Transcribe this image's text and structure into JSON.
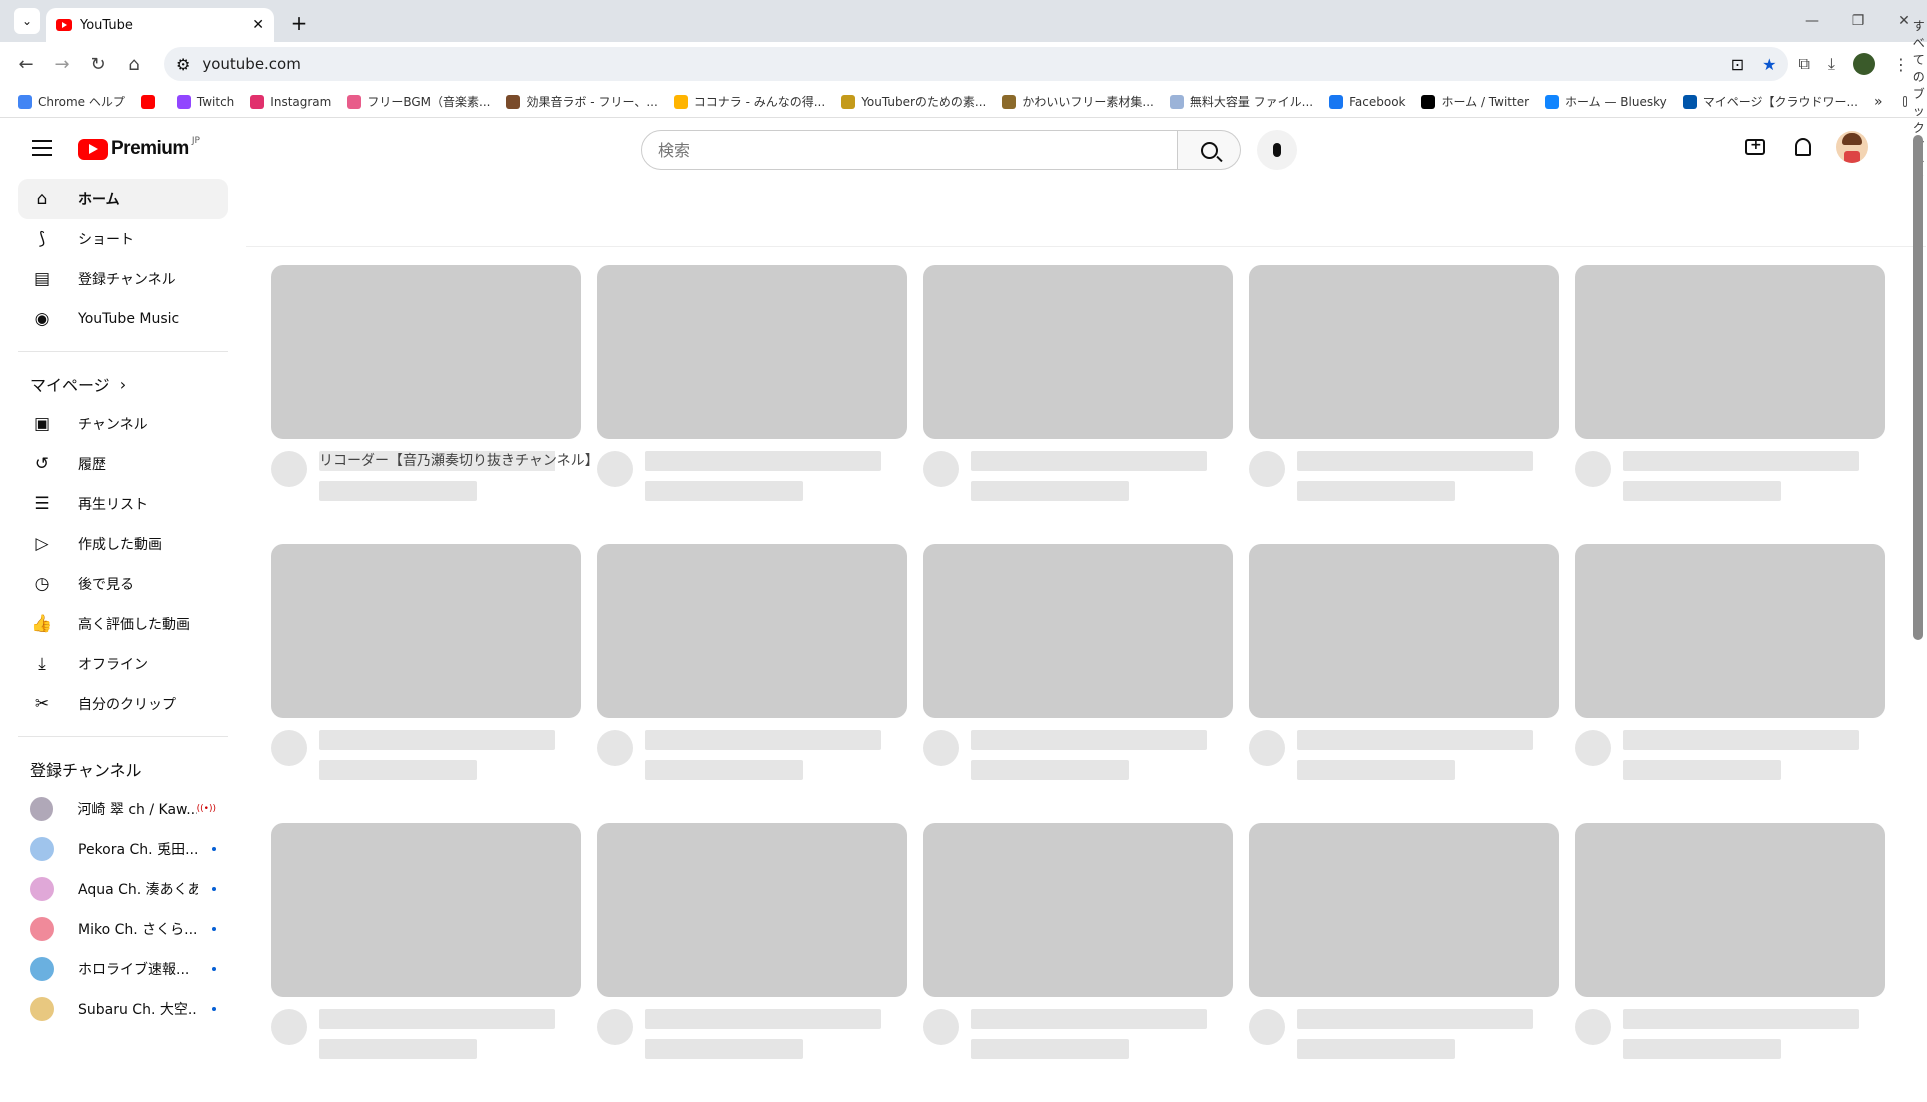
{
  "browser": {
    "tab_title": "YouTube",
    "url": "youtube.com",
    "bookmarks": [
      {
        "label": "Chrome ヘルプ",
        "color": "#4285f4"
      },
      {
        "label": "",
        "color": "#ff0000"
      },
      {
        "label": "Twitch",
        "color": "#9146ff"
      },
      {
        "label": "Instagram",
        "color": "#e1306c"
      },
      {
        "label": "フリーBGM（音楽素...",
        "color": "#e85c8a"
      },
      {
        "label": "効果音ラボ - フリー、...",
        "color": "#7a4b2a"
      },
      {
        "label": "ココナラ - みんなの得...",
        "color": "#ffb400"
      },
      {
        "label": "YouTuberのための素...",
        "color": "#c49a1a"
      },
      {
        "label": "かわいいフリー素材集...",
        "color": "#8b6a2b"
      },
      {
        "label": "無料大容量 ファイル...",
        "color": "#9bb3d8"
      },
      {
        "label": "Facebook",
        "color": "#1877f2"
      },
      {
        "label": "ホーム / Twitter",
        "color": "#000000"
      },
      {
        "label": "ホーム — Bluesky",
        "color": "#1185fe"
      },
      {
        "label": "マイページ【クラウドワー...",
        "color": "#0055aa"
      }
    ],
    "all_bookmarks": "すべてのブックマーク"
  },
  "youtube": {
    "logo_text": "Premium",
    "logo_region": "JP",
    "search_placeholder": "検索",
    "sidebar": {
      "main": [
        {
          "label": "ホーム",
          "icon": "home-icon",
          "glyph": "⌂",
          "active": true
        },
        {
          "label": "ショート",
          "icon": "shorts-icon",
          "glyph": "⟆",
          "active": false
        },
        {
          "label": "登録チャンネル",
          "icon": "subscriptions-icon",
          "glyph": "▤",
          "active": false
        },
        {
          "label": "YouTube Music",
          "icon": "music-icon",
          "glyph": "◉",
          "active": false
        }
      ],
      "mypage_header": "マイページ",
      "mypage": [
        {
          "label": "チャンネル",
          "icon": "channel-icon",
          "glyph": "▣"
        },
        {
          "label": "履歴",
          "icon": "history-icon",
          "glyph": "↺"
        },
        {
          "label": "再生リスト",
          "icon": "playlist-icon",
          "glyph": "☰"
        },
        {
          "label": "作成した動画",
          "icon": "your-videos-icon",
          "glyph": "▷"
        },
        {
          "label": "後で見る",
          "icon": "watch-later-icon",
          "glyph": "◷"
        },
        {
          "label": "高く評価した動画",
          "icon": "liked-icon",
          "glyph": "👍"
        },
        {
          "label": "オフライン",
          "icon": "download-icon",
          "glyph": "⤓"
        },
        {
          "label": "自分のクリップ",
          "icon": "clip-icon",
          "glyph": "✂"
        }
      ],
      "subs_header": "登録チャンネル",
      "subscriptions": [
        {
          "name": "河崎 翠 ch / Kaw...",
          "color": "#b0a8b8",
          "status": "live"
        },
        {
          "name": "Pekora Ch. 兎田...",
          "color": "#9fc4ec",
          "status": "new"
        },
        {
          "name": "Aqua Ch. 湊あくあ",
          "color": "#e0a8d8",
          "status": "new"
        },
        {
          "name": "Miko Ch. さくら...",
          "color": "#f08a9a",
          "status": "new"
        },
        {
          "name": "ホロライブ速報...",
          "color": "#6ab0e0",
          "status": "new"
        },
        {
          "name": "Subaru Ch. 大空...",
          "color": "#e8c880",
          "status": "new"
        }
      ],
      "live_glyph": "((•))"
    },
    "first_card_title": "リコーダー【音乃瀬奏切り抜きチャンネル】"
  }
}
